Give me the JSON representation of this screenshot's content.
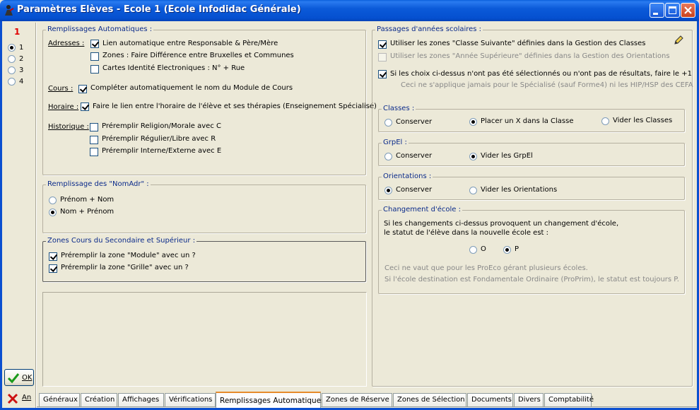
{
  "window": {
    "title": "Paramètres Elèves - Ecole 1 (Ecole Infodidac Générale)"
  },
  "left": {
    "mode_number": "1",
    "radios": [
      {
        "label": "1",
        "selected": true
      },
      {
        "label": "2",
        "selected": false
      },
      {
        "label": "3",
        "selected": false
      },
      {
        "label": "4",
        "selected": false
      }
    ],
    "ok_label": "OK",
    "cancel_label": "An"
  },
  "remplissages": {
    "title": "Remplissages Automatiques :",
    "adresses_label": "Adresses :",
    "adresses": [
      {
        "label": "Lien automatique entre Responsable & Père/Mère",
        "checked": true
      },
      {
        "label": "Zones : Faire Différence entre Bruxelles et Communes",
        "checked": false
      },
      {
        "label": "Cartes Identité Electroniques : N° + Rue",
        "checked": false
      }
    ],
    "cours_label": "Cours :",
    "cours": {
      "label": "Compléter automatiquement le nom du Module de Cours",
      "checked": true
    },
    "horaire_label": "Horaire :",
    "horaire": {
      "label": "Faire le lien entre l'horaire de l'élève et ses thérapies (Enseignement Spécialisé)",
      "checked": true
    },
    "historique_label": "Historique :",
    "historique": [
      {
        "label": "Préremplir Religion/Morale avec C",
        "checked": false
      },
      {
        "label": "Préremplir Régulier/Libre avec R",
        "checked": false
      },
      {
        "label": "Préremplir Interne/Externe avec E",
        "checked": false
      }
    ]
  },
  "nomadr": {
    "title": "Remplissage des \"NomAdr\" :",
    "options": [
      {
        "label": "Prénom + Nom",
        "selected": false
      },
      {
        "label": "Nom + Prénom",
        "selected": true
      }
    ]
  },
  "zones_cours": {
    "title": "Zones Cours du Secondaire et Supérieur :",
    "options": [
      {
        "label": "Préremplir la zone \"Module\" avec un ?",
        "checked": true
      },
      {
        "label": "Préremplir la zone \"Grille\" avec un ?",
        "checked": true
      }
    ]
  },
  "passages": {
    "title": "Passages d'années scolaires :",
    "opt1": {
      "label": "Utiliser les zones  \"Classe Suivante\" définies dans la Gestion des Classes",
      "checked": true
    },
    "opt2": {
      "label": "Utiliser les zones  \"Année Supérieure\" définies dans la Gestion des Orientations",
      "checked": false
    },
    "opt3": {
      "label": "Si les choix ci-dessus n'ont pas été sélectionnés ou n'ont pas de résultats, faire le +1",
      "checked": true
    },
    "note": "Ceci ne s'applique jamais pour le Spécialisé (sauf Forme4) ni les HIP/HSP des CEFA",
    "classes": {
      "title": "Classes :",
      "options": [
        {
          "label": "Conserver",
          "selected": false
        },
        {
          "label": "Placer un X dans la Classe",
          "selected": true
        },
        {
          "label": "Vider les Classes",
          "selected": false
        }
      ]
    },
    "grpel": {
      "title": "GrpEl :",
      "options": [
        {
          "label": "Conserver",
          "selected": false
        },
        {
          "label": "Vider les GrpEl",
          "selected": true
        }
      ]
    },
    "orientations": {
      "title": "Orientations :",
      "options": [
        {
          "label": "Conserver",
          "selected": true
        },
        {
          "label": "Vider les Orientations",
          "selected": false
        }
      ]
    },
    "changement": {
      "title": "Changement d'école :",
      "line1": "Si les changements ci-dessus provoquent un changement d'école,",
      "line2": "le statut de l'élève dans la nouvelle école est :",
      "options": [
        {
          "label": "O",
          "selected": false
        },
        {
          "label": "P",
          "selected": true
        }
      ],
      "note1": "Ceci ne vaut que pour les ProEco gérant plusieurs écoles.",
      "note2": "Si l'école destination est Fondamentale Ordinaire (ProPrim), le statut est toujours P."
    }
  },
  "tabs": [
    {
      "label": "Généraux",
      "active": false
    },
    {
      "label": "Création",
      "active": false
    },
    {
      "label": "Affichages",
      "active": false
    },
    {
      "label": "Vérifications",
      "active": false
    },
    {
      "label": "Remplissages Automatiques",
      "active": true
    },
    {
      "label": "Zones de Réserve",
      "active": false
    },
    {
      "label": "Zones de Sélection",
      "active": false
    },
    {
      "label": "Documents",
      "active": false
    },
    {
      "label": "Divers",
      "active": false
    },
    {
      "label": "Comptabilité",
      "active": false
    }
  ],
  "colors": {
    "titlebar": "#0b5ad9",
    "mode_number": "#e00000",
    "tab_highlight": "#e68b2c"
  }
}
